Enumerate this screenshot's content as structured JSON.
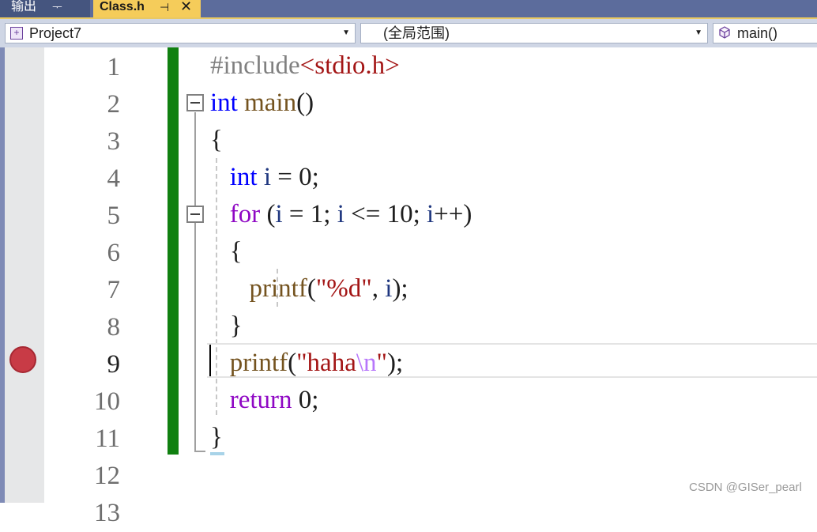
{
  "tabs": {
    "output_label": "输出",
    "output_pin": "ᅮ",
    "active_label": "Class.h",
    "active_pin": "⊣",
    "close_glyph": "✕"
  },
  "navbar": {
    "project": "Project7",
    "scope": "(全局范围)",
    "function": "main()",
    "dropdown_glyph": "▼"
  },
  "editor": {
    "line_numbers": [
      "1",
      "2",
      "3",
      "4",
      "5",
      "6",
      "7",
      "8",
      "9",
      "10",
      "11",
      "12",
      "13"
    ],
    "current_line": 9,
    "breakpoint_line": 9,
    "code": {
      "l1_directive": "#include",
      "l1_header": "<stdio.h>",
      "l2_type": "int",
      "l2_name": " main",
      "l2_rest": "()",
      "l3": "{",
      "l4_indent": "   ",
      "l4_type": "int",
      "l4_var": " i",
      "l4_rest": " = 0;",
      "l5_indent": "   ",
      "l5_kw": "for",
      "l5_a": " (",
      "l5_v1": "i",
      "l5_b": " = 1; ",
      "l5_v2": "i",
      "l5_c": " <= 10; ",
      "l5_v3": "i",
      "l5_d": "++)",
      "l6": "   {",
      "l7_indent": "      ",
      "l7_fn": "printf",
      "l7_a": "(",
      "l7_str": "\"%d\"",
      "l7_b": ", ",
      "l7_var": "i",
      "l7_c": ");",
      "l8": "   }",
      "l9_indent": "   ",
      "l9_fn": "printf",
      "l9_a": "(",
      "l9_str1": "\"haha",
      "l9_esc": "\\n",
      "l9_str2": "\"",
      "l9_b": ");",
      "l10_indent": "   ",
      "l10_kw": "return",
      "l10_rest": " 0;",
      "l11": "}"
    }
  },
  "colors": {
    "keyword": "#0000ff",
    "control": "#8f08c4",
    "function": "#74531f",
    "string": "#a31515",
    "escape": "#b776fb",
    "preprocessor": "#808080",
    "variable": "#1f377f",
    "change_bar": "#108010",
    "breakpoint": "#c83b46",
    "active_tab": "#f5cc5a"
  },
  "watermark": "CSDN @GISer_pearl"
}
